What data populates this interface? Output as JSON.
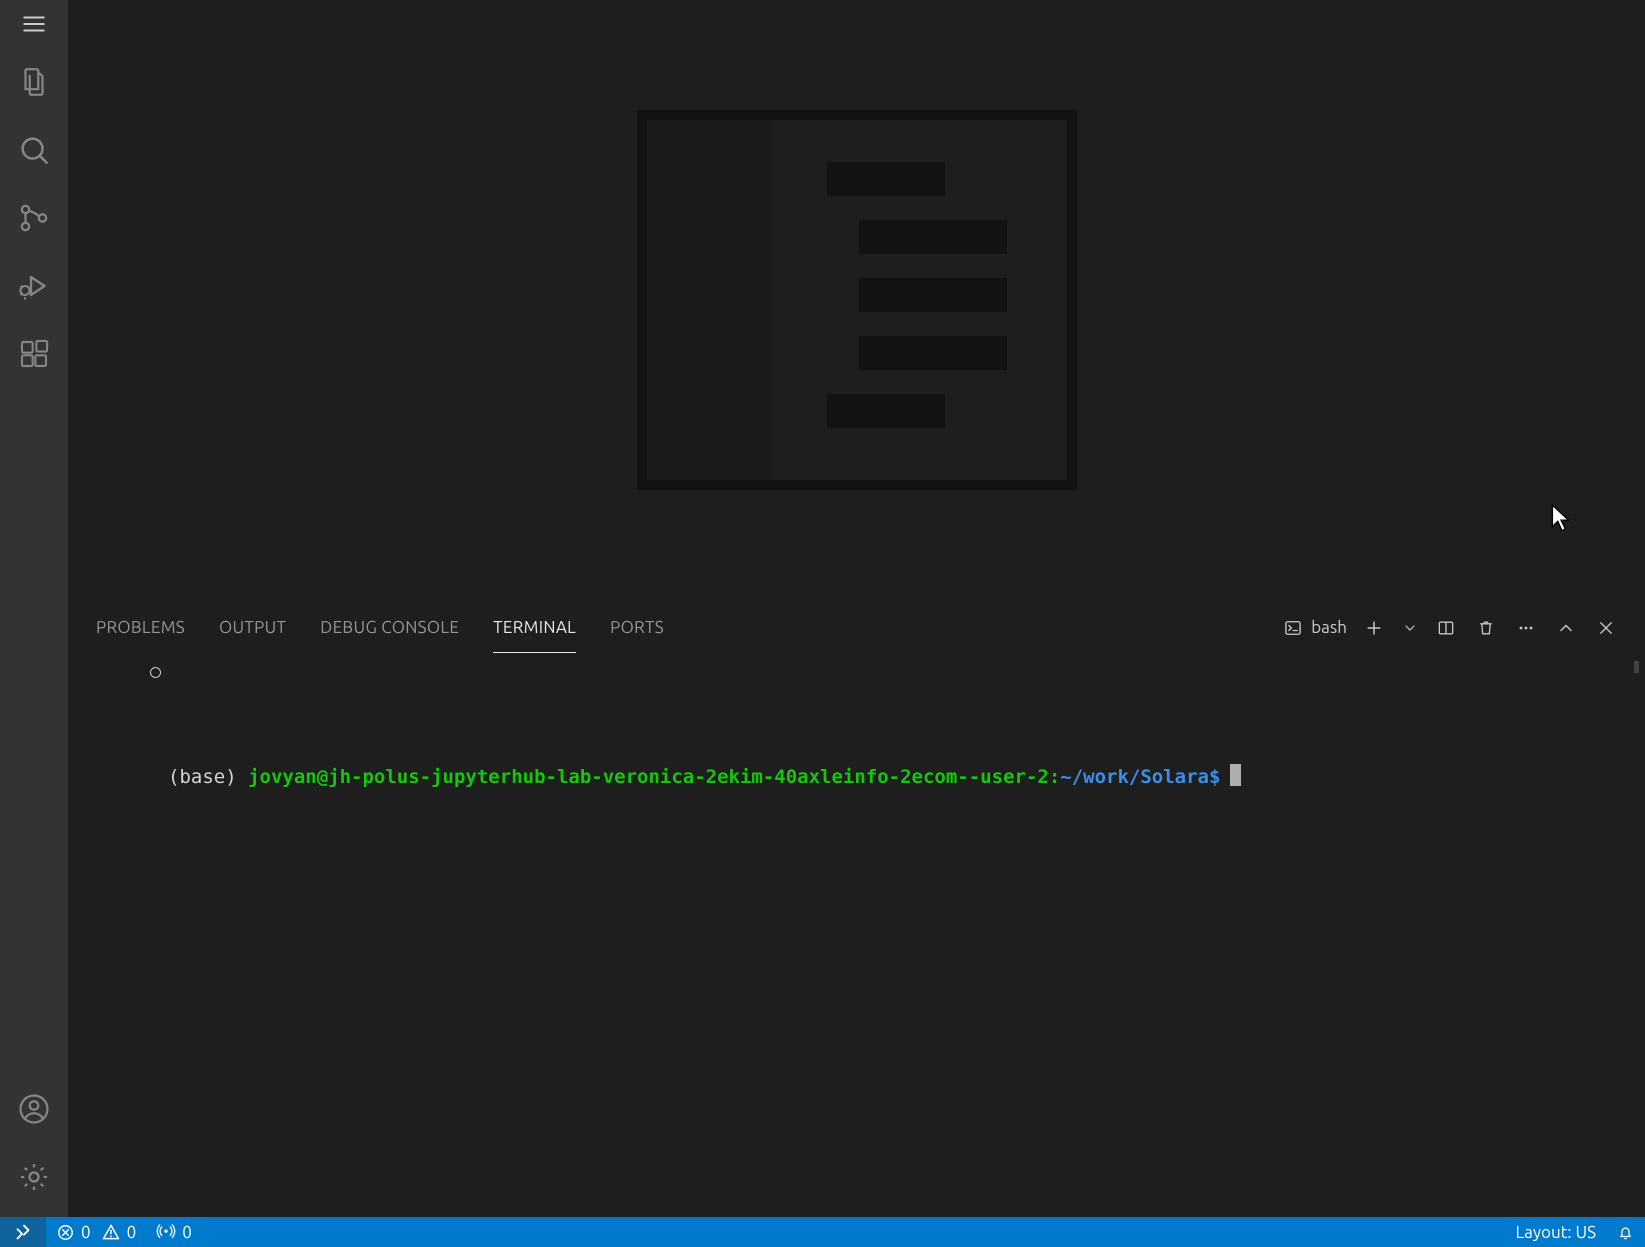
{
  "panel": {
    "tabs": {
      "problems": "PROBLEMS",
      "output": "OUTPUT",
      "debug_console": "DEBUG CONSOLE",
      "terminal": "TERMINAL",
      "ports": "PORTS"
    },
    "shell_label": "bash"
  },
  "terminal": {
    "env": "(base)",
    "user_host": "jovyan@jh-polus-jupyterhub-lab-veronica-2ekim-40axleinfo-2ecom--user-2",
    "colon": ":",
    "path": "~/work/Solara",
    "prompt_symbol": "$"
  },
  "status": {
    "errors": "0",
    "warnings": "0",
    "ports": "0",
    "layout": "Layout: US"
  }
}
